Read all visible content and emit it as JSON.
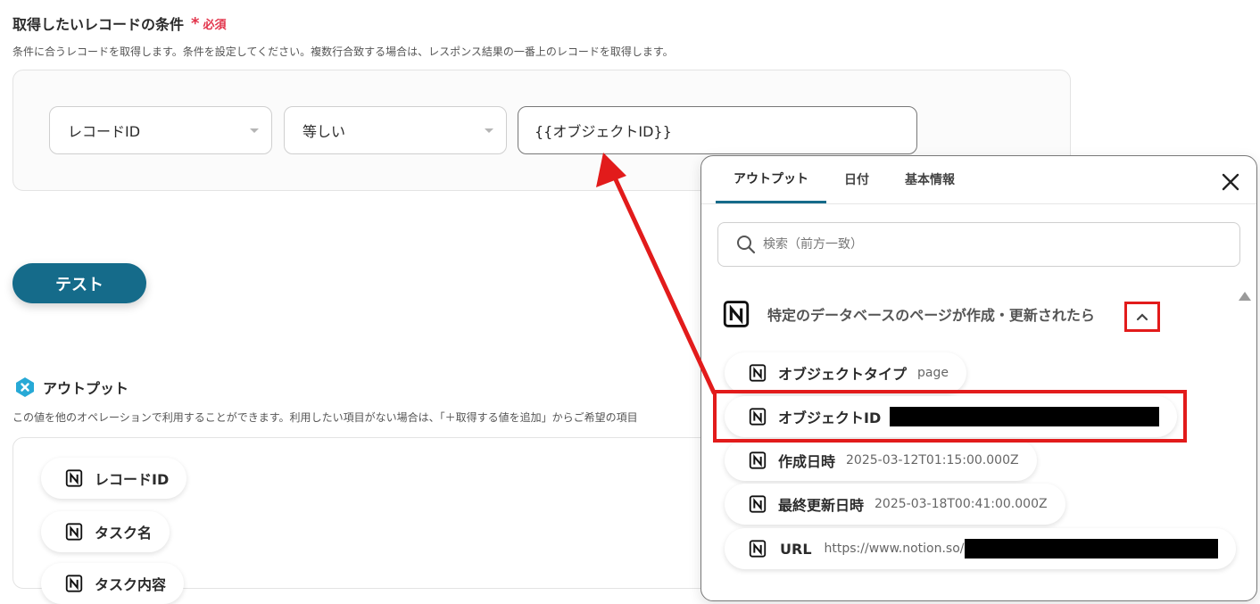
{
  "condition": {
    "title": "取得したいレコードの条件",
    "required_mark": "*",
    "required_label": "必須",
    "description": "条件に合うレコードを取得します。条件を設定してください。複数行合致する場合は、レスポンス結果の一番上のレコードを取得します。",
    "field_select": "レコードID",
    "operator_select": "等しい",
    "value": "{{オブジェクトID}}"
  },
  "test_button": "テスト",
  "output": {
    "title": "アウトプット",
    "description": "この値を他のオペレーションで利用することができます。利用したい項目がない場合は、「＋取得する値を追加」からご希望の項目",
    "items": [
      "レコードID",
      "タスク名",
      "タスク内容"
    ]
  },
  "panel": {
    "tabs": [
      "アウトプット",
      "日付",
      "基本情報"
    ],
    "search_placeholder": "検索（前方一致）",
    "group_title": "特定のデータベースのページが作成・更新されたら",
    "items": [
      {
        "label": "オブジェクトタイプ",
        "value": "page"
      },
      {
        "label": "オブジェクトID",
        "value": ""
      },
      {
        "label": "作成日時",
        "value": "2025-03-12T01:15:00.000Z"
      },
      {
        "label": "最終更新日時",
        "value": "2025-03-18T00:41:00.000Z"
      },
      {
        "label": "URL",
        "value": "https://www.notion.so/"
      }
    ]
  },
  "colors": {
    "accent": "#156b8a",
    "annotation_red": "#e21b1b",
    "required_red": "#e2334a"
  },
  "icons": {
    "notion": "notion-icon",
    "output": "hexagon-x-icon",
    "search": "search-icon",
    "close": "close-icon",
    "collapse": "chevron-up-icon"
  }
}
